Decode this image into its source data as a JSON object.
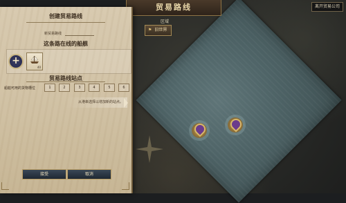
{
  "title": "贸易路线",
  "top_right_button": "离开贸易公司",
  "region": {
    "label": "区域",
    "selected": "旧世界",
    "icon": "flag-icon"
  },
  "panel": {
    "create_title": "创建贸易路线",
    "route_name_label": "新贸易路线",
    "ships_title": "这条路在线的船舰",
    "add_ship_icon": "plus-icon",
    "ship_count": "40",
    "stations_title": "贸易路线站点",
    "cargo_label": "船舶可用的货物槽位",
    "cargo_slots": [
      "1",
      "2",
      "3",
      "4",
      "5",
      "6"
    ],
    "hint": "从港串选择以增加新的站点。"
  },
  "buttons": {
    "confirm": "接受",
    "cancel": "取消"
  },
  "colors": {
    "parchment": "#d8cab0",
    "sea": "#5f7578",
    "accent_gold": "#b79c63"
  }
}
